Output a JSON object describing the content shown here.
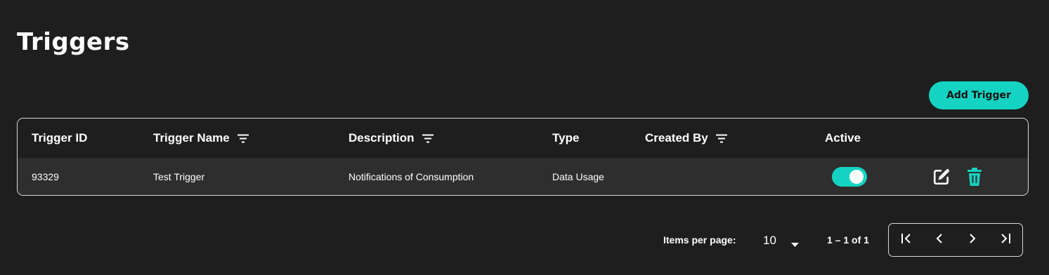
{
  "page": {
    "title": "Triggers"
  },
  "toolbar": {
    "add_label": "Add Trigger"
  },
  "table": {
    "columns": [
      {
        "key": "id",
        "label": "Trigger ID",
        "sortable": false
      },
      {
        "key": "name",
        "label": "Trigger Name",
        "sortable": true
      },
      {
        "key": "description",
        "label": "Description",
        "sortable": true
      },
      {
        "key": "type",
        "label": "Type",
        "sortable": false
      },
      {
        "key": "created_by",
        "label": "Created By",
        "sortable": true
      },
      {
        "key": "active",
        "label": "Active",
        "sortable": false
      }
    ],
    "rows": [
      {
        "id": "93329",
        "name": "Test Trigger",
        "description": "Notifications of Consumption",
        "type": "Data Usage",
        "created_by": "",
        "active": true
      }
    ]
  },
  "icons": {
    "sort": "filter-list-icon",
    "edit": "edit-icon",
    "delete": "trash-icon",
    "first": "first-page-icon",
    "prev": "chevron-left-icon",
    "next": "chevron-right-icon",
    "last": "last-page-icon",
    "dropdown": "arrow-drop-down-icon"
  },
  "colors": {
    "background": "#1e1e1e",
    "row_background": "#2e2e2e",
    "accent": "#14d3c2",
    "border": "#d9d9d9"
  },
  "paginator": {
    "items_per_page_label": "Items per page:",
    "page_size": "10",
    "range_label": "1 – 1 of 1"
  }
}
